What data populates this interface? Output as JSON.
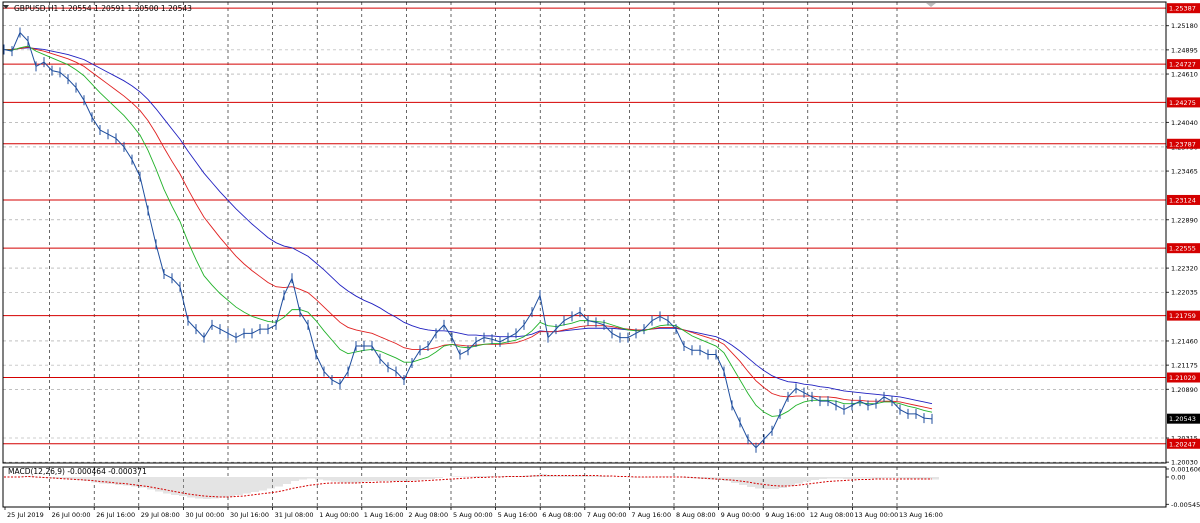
{
  "chart_data": [
    {
      "type": "line",
      "title": "GBPUSD,H1 1.20554 1.20591 1.20500 1.20543",
      "symbol_label": "GBPUSD,H1",
      "ohlc": [
        1.20554,
        1.20591,
        1.205,
        1.20543
      ],
      "ylim": [
        1.2002,
        1.2546
      ],
      "y_ticks": [
        "1.25180",
        "1.24895",
        "1.24610",
        "1.24040",
        "1.23750",
        "1.23465",
        "1.22890",
        "1.22320",
        "1.22035",
        "1.21460",
        "1.21175",
        "1.20890",
        "1.20315",
        "1.20030"
      ],
      "x_ticks": [
        "25 Jul 2019",
        "26 Jul 00:00",
        "26 Jul 16:00",
        "29 Jul 08:00",
        "30 Jul 00:00",
        "30 Jul 16:00",
        "31 Jul 08:00",
        "1 Aug 00:00",
        "1 Aug 16:00",
        "2 Aug 08:00",
        "5 Aug 00:00",
        "5 Aug 16:00",
        "6 Aug 08:00",
        "7 Aug 00:00",
        "7 Aug 16:00",
        "8 Aug 08:00",
        "9 Aug 00:00",
        "9 Aug 16:00",
        "12 Aug 08:00",
        "13 Aug 00:00",
        "13 Aug 16:00"
      ],
      "x": [
        0,
        8,
        16,
        24,
        32,
        40,
        48,
        56,
        64,
        72,
        80,
        88,
        96,
        104,
        112,
        120,
        128,
        136,
        144,
        152,
        160,
        168,
        176,
        184,
        192,
        200,
        208,
        216,
        224,
        232,
        240,
        248,
        256,
        264,
        272,
        280,
        288,
        296,
        304,
        312,
        320,
        328,
        336,
        344,
        352,
        360,
        368,
        376,
        384,
        392,
        400,
        408,
        416,
        424,
        432,
        440,
        448,
        456,
        464,
        472,
        480,
        488,
        496,
        504,
        512,
        520,
        528,
        536,
        544,
        552,
        560,
        568,
        576,
        584,
        592,
        600,
        608,
        616,
        624,
        632,
        640,
        648,
        656,
        664,
        672,
        680,
        688,
        696,
        704,
        712,
        720,
        728,
        736,
        744,
        752,
        760,
        768,
        776,
        784,
        792,
        800,
        808,
        816,
        824,
        832,
        840,
        848,
        856,
        864,
        872,
        880,
        888,
        896,
        904,
        912,
        920,
        928
      ],
      "price": [
        1.249,
        1.2488,
        1.251,
        1.25,
        1.247,
        1.2475,
        1.2465,
        1.2463,
        1.2455,
        1.2445,
        1.243,
        1.241,
        1.2395,
        1.239,
        1.2385,
        1.2375,
        1.236,
        1.234,
        1.23,
        1.226,
        1.2225,
        1.222,
        1.221,
        1.217,
        1.216,
        1.215,
        1.2165,
        1.216,
        1.2155,
        1.215,
        1.2155,
        1.2155,
        1.216,
        1.216,
        1.2165,
        1.22,
        1.222,
        1.218,
        1.2165,
        1.213,
        1.211,
        1.21,
        1.2095,
        1.211,
        1.214,
        1.214,
        1.214,
        1.2125,
        1.2115,
        1.211,
        1.21,
        1.212,
        1.2135,
        1.214,
        1.2155,
        1.2165,
        1.215,
        1.213,
        1.2135,
        1.2145,
        1.215,
        1.2148,
        1.2145,
        1.215,
        1.2155,
        1.2165,
        1.218,
        1.22,
        1.215,
        1.216,
        1.217,
        1.2175,
        1.218,
        1.217,
        1.2168,
        1.2165,
        1.2155,
        1.215,
        1.215,
        1.2155,
        1.216,
        1.217,
        1.2175,
        1.217,
        1.216,
        1.214,
        1.2135,
        1.2135,
        1.213,
        1.213,
        1.211,
        1.207,
        1.205,
        1.203,
        1.202,
        1.203,
        1.204,
        1.206,
        1.208,
        1.209,
        1.2085,
        1.208,
        1.2075,
        1.2075,
        1.207,
        1.2065,
        1.207,
        1.2075,
        1.207,
        1.2072,
        1.208,
        1.2075,
        1.2065,
        1.206,
        1.206,
        1.2055,
        1.2054
      ],
      "ma_fast": [
        1.249,
        1.2489,
        1.2492,
        1.2494,
        1.2488,
        1.2484,
        1.248,
        1.2476,
        1.2472,
        1.2466,
        1.2459,
        1.2449,
        1.2439,
        1.243,
        1.2421,
        1.2412,
        1.2401,
        1.2389,
        1.2371,
        1.2349,
        1.2325,
        1.2305,
        1.2287,
        1.2263,
        1.2242,
        1.2223,
        1.2212,
        1.2202,
        1.2194,
        1.2186,
        1.218,
        1.2175,
        1.2172,
        1.2169,
        1.2168,
        1.2174,
        1.2183,
        1.2183,
        1.218,
        1.217,
        1.2158,
        1.2147,
        1.2136,
        1.2131,
        1.2133,
        1.2135,
        1.2136,
        1.2134,
        1.213,
        1.2126,
        1.2121,
        1.2121,
        1.2124,
        1.2127,
        1.2133,
        1.214,
        1.2142,
        1.2139,
        1.2138,
        1.214,
        1.2142,
        1.2143,
        1.2143,
        1.2145,
        1.2147,
        1.2151,
        1.2158,
        1.2168,
        1.2164,
        1.2163,
        1.2165,
        1.2167,
        1.217,
        1.217,
        1.2169,
        1.2168,
        1.2165,
        1.2162,
        1.2159,
        1.2158,
        1.2158,
        1.2161,
        1.2164,
        1.2165,
        1.2164,
        1.2158,
        1.2152,
        1.2148,
        1.2144,
        1.214,
        1.2132,
        1.2116,
        1.21,
        1.2084,
        1.207,
        1.2062,
        1.2057,
        1.2058,
        1.2063,
        1.207,
        1.2074,
        1.2076,
        1.2076,
        1.2076,
        1.2075,
        1.2072,
        1.2072,
        1.2073,
        1.2072,
        1.2072,
        1.2074,
        1.2074,
        1.2072,
        1.2069,
        1.2067,
        1.2064,
        1.2062
      ],
      "ma_mid": [
        1.249,
        1.249,
        1.2491,
        1.2493,
        1.249,
        1.2488,
        1.2485,
        1.2482,
        1.2479,
        1.2475,
        1.247,
        1.2463,
        1.2456,
        1.2449,
        1.2442,
        1.2435,
        1.2427,
        1.2418,
        1.2406,
        1.2391,
        1.2374,
        1.2358,
        1.2343,
        1.2325,
        1.2308,
        1.2292,
        1.228,
        1.2268,
        1.2257,
        1.2246,
        1.2237,
        1.2229,
        1.2222,
        1.2215,
        1.221,
        1.2209,
        1.221,
        1.2207,
        1.2203,
        1.2195,
        1.2186,
        1.2177,
        1.2168,
        1.2162,
        1.2159,
        1.2157,
        1.2155,
        1.2151,
        1.2147,
        1.2143,
        1.2138,
        1.2136,
        1.2136,
        1.2136,
        1.2138,
        1.2141,
        1.2142,
        1.2141,
        1.214,
        1.2141,
        1.2142,
        1.2142,
        1.2142,
        1.2143,
        1.2144,
        1.2147,
        1.2151,
        1.2157,
        1.2157,
        1.2157,
        1.2159,
        1.2161,
        1.2163,
        1.2164,
        1.2164,
        1.2164,
        1.2163,
        1.2161,
        1.216,
        1.2159,
        1.2159,
        1.216,
        1.2162,
        1.2162,
        1.2162,
        1.2159,
        1.2156,
        1.2153,
        1.215,
        1.2147,
        1.2142,
        1.2132,
        1.2122,
        1.211,
        1.2099,
        1.2091,
        1.2084,
        1.2081,
        1.208,
        1.2081,
        1.2081,
        1.2081,
        1.208,
        1.208,
        1.2079,
        1.2077,
        1.2076,
        1.2076,
        1.2075,
        1.2075,
        1.2075,
        1.2075,
        1.2074,
        1.2072,
        1.207,
        1.2068,
        1.2066
      ],
      "ma_slow": [
        1.249,
        1.249,
        1.2491,
        1.2492,
        1.2491,
        1.249,
        1.2488,
        1.2486,
        1.2484,
        1.2481,
        1.2478,
        1.2473,
        1.2468,
        1.2463,
        1.2458,
        1.2453,
        1.2447,
        1.244,
        1.2431,
        1.242,
        1.2408,
        1.2396,
        1.2384,
        1.237,
        1.2357,
        1.2344,
        1.2333,
        1.2322,
        1.2312,
        1.2302,
        1.2293,
        1.2284,
        1.2276,
        1.2268,
        1.2262,
        1.2258,
        1.2256,
        1.2251,
        1.2246,
        1.2238,
        1.223,
        1.2221,
        1.2212,
        1.2205,
        1.2199,
        1.2194,
        1.219,
        1.2185,
        1.2179,
        1.2174,
        1.2168,
        1.2164,
        1.2161,
        1.2159,
        1.2158,
        1.2158,
        1.2157,
        1.2155,
        1.2153,
        1.2153,
        1.2152,
        1.2152,
        1.2151,
        1.2151,
        1.2151,
        1.2152,
        1.2154,
        1.2158,
        1.2157,
        1.2157,
        1.2158,
        1.2159,
        1.216,
        1.2161,
        1.2161,
        1.2161,
        1.2161,
        1.216,
        1.2159,
        1.2159,
        1.2159,
        1.216,
        1.2161,
        1.2161,
        1.2161,
        1.2159,
        1.2157,
        1.2155,
        1.2153,
        1.2151,
        1.2147,
        1.2141,
        1.2134,
        1.2126,
        1.2118,
        1.2111,
        1.2105,
        1.2101,
        1.2098,
        1.2097,
        1.2095,
        1.2094,
        1.2092,
        1.2091,
        1.2089,
        1.2087,
        1.2086,
        1.2085,
        1.2084,
        1.2083,
        1.2082,
        1.2081,
        1.208,
        1.2078,
        1.2076,
        1.2074,
        1.2072
      ],
      "level_lines": [
        "1.25387",
        "1.24727",
        "1.24275",
        "1.23787",
        "1.23124",
        "1.22555",
        "1.21759",
        "1.21029",
        "1.20247"
      ],
      "current_price_label": "1.20543",
      "colors": {
        "price": "#1f4e9e",
        "ma_fast": "#22b22a",
        "ma_mid": "#e02020",
        "ma_slow": "#2020c0",
        "level": "#d40000",
        "grid": "#9a9a9a"
      }
    },
    {
      "type": "bar",
      "title": "MACD(12,26,9) -0.000464 -0.000371",
      "ylim": [
        -0.006,
        0.002
      ],
      "y_ticks": [
        "0.001606",
        "0.00",
        "-0.005458"
      ],
      "x": [
        0,
        8,
        16,
        24,
        32,
        40,
        48,
        56,
        64,
        72,
        80,
        88,
        96,
        104,
        112,
        120,
        128,
        136,
        144,
        152,
        160,
        168,
        176,
        184,
        192,
        200,
        208,
        216,
        224,
        232,
        240,
        248,
        256,
        264,
        272,
        280,
        288,
        296,
        304,
        312,
        320,
        328,
        336,
        344,
        352,
        360,
        368,
        376,
        384,
        392,
        400,
        408,
        416,
        424,
        432,
        440,
        448,
        456,
        464,
        472,
        480,
        488,
        496,
        504,
        512,
        520,
        528,
        536,
        544,
        552,
        560,
        568,
        576,
        584,
        592,
        600,
        608,
        616,
        624,
        632,
        640,
        648,
        656,
        664,
        672,
        680,
        688,
        696,
        704,
        712,
        720,
        728,
        736,
        744,
        752,
        760,
        768,
        776,
        784,
        792,
        800,
        808,
        816,
        824,
        832,
        840,
        848,
        856,
        864,
        872,
        880,
        888,
        896,
        904,
        912,
        920,
        928
      ],
      "macd": [
        0.0,
        0.0,
        0.0001,
        0.0002,
        -0.0001,
        -0.0002,
        -0.0003,
        -0.0004,
        -0.0005,
        -0.0006,
        -0.0008,
        -0.0011,
        -0.0013,
        -0.0014,
        -0.0016,
        -0.0017,
        -0.0019,
        -0.0021,
        -0.0025,
        -0.0029,
        -0.0033,
        -0.0036,
        -0.0038,
        -0.0041,
        -0.0043,
        -0.0044,
        -0.0043,
        -0.0041,
        -0.0039,
        -0.0036,
        -0.0033,
        -0.003,
        -0.0027,
        -0.0023,
        -0.0019,
        -0.0014,
        -0.0008,
        -0.0005,
        -0.0003,
        -0.0005,
        -0.0007,
        -0.0009,
        -0.0011,
        -0.0012,
        -0.0011,
        -0.0009,
        -0.0008,
        -0.0008,
        -0.0008,
        -0.0008,
        -0.0008,
        -0.0007,
        -0.0005,
        -0.0004,
        -0.0002,
        0.0,
        0.0001,
        0.0001,
        0.0001,
        0.0002,
        0.0002,
        0.0002,
        0.0002,
        0.0002,
        0.0002,
        0.0003,
        0.0004,
        0.0006,
        0.0004,
        0.0003,
        0.0003,
        0.0003,
        0.0003,
        0.0002,
        0.0002,
        0.0001,
        0.0,
        0.0,
        -0.0001,
        -0.0001,
        -0.0001,
        0.0,
        0.0001,
        0.0001,
        0.0,
        -0.0002,
        -0.0003,
        -0.0004,
        -0.0005,
        -0.0006,
        -0.0008,
        -0.0012,
        -0.0016,
        -0.002,
        -0.0023,
        -0.0024,
        -0.0024,
        -0.0022,
        -0.0018,
        -0.0013,
        -0.0009,
        -0.0006,
        -0.0004,
        -0.0003,
        -0.0003,
        -0.0004,
        -0.0004,
        -0.0003,
        -0.0003,
        -0.0003,
        -0.0002,
        -0.0002,
        -0.0003,
        -0.0004,
        -0.0004,
        -0.0005,
        -0.0005
      ],
      "signal": [
        0.0,
        0.0,
        0.0,
        0.0001,
        0.0,
        -0.0001,
        -0.0002,
        -0.0003,
        -0.0004,
        -0.0005,
        -0.0006,
        -0.0007,
        -0.0009,
        -0.001,
        -0.0012,
        -0.0013,
        -0.0015,
        -0.0017,
        -0.0019,
        -0.0022,
        -0.0025,
        -0.0028,
        -0.0031,
        -0.0034,
        -0.0036,
        -0.0038,
        -0.0039,
        -0.004,
        -0.004,
        -0.0039,
        -0.0038,
        -0.0036,
        -0.0034,
        -0.0032,
        -0.003,
        -0.0027,
        -0.0023,
        -0.002,
        -0.0017,
        -0.0015,
        -0.0013,
        -0.0012,
        -0.0012,
        -0.0012,
        -0.0012,
        -0.0011,
        -0.0011,
        -0.001,
        -0.001,
        -0.0009,
        -0.0009,
        -0.0009,
        -0.0008,
        -0.0007,
        -0.0006,
        -0.0005,
        -0.0004,
        -0.0003,
        -0.0002,
        -0.0001,
        -0.0001,
        0.0,
        0.0,
        0.0001,
        0.0001,
        0.0001,
        0.0002,
        0.0003,
        0.0003,
        0.0003,
        0.0003,
        0.0003,
        0.0003,
        0.0003,
        0.0003,
        0.0002,
        0.0002,
        0.0001,
        0.0001,
        0.0,
        0.0,
        0.0,
        0.0,
        0.0,
        0.0,
        0.0,
        -0.0001,
        -0.0002,
        -0.0003,
        -0.0004,
        -0.0005,
        -0.0006,
        -0.0008,
        -0.001,
        -0.0013,
        -0.0015,
        -0.0017,
        -0.0018,
        -0.0018,
        -0.0017,
        -0.0015,
        -0.0013,
        -0.0011,
        -0.0009,
        -0.0008,
        -0.0007,
        -0.0006,
        -0.0005,
        -0.0005,
        -0.0004,
        -0.0004,
        -0.0004,
        -0.0004,
        -0.0004,
        -0.0004,
        -0.0004,
        -0.0004
      ],
      "colors": {
        "histogram": "#c8c8c8",
        "signal": "#d40000"
      }
    }
  ]
}
